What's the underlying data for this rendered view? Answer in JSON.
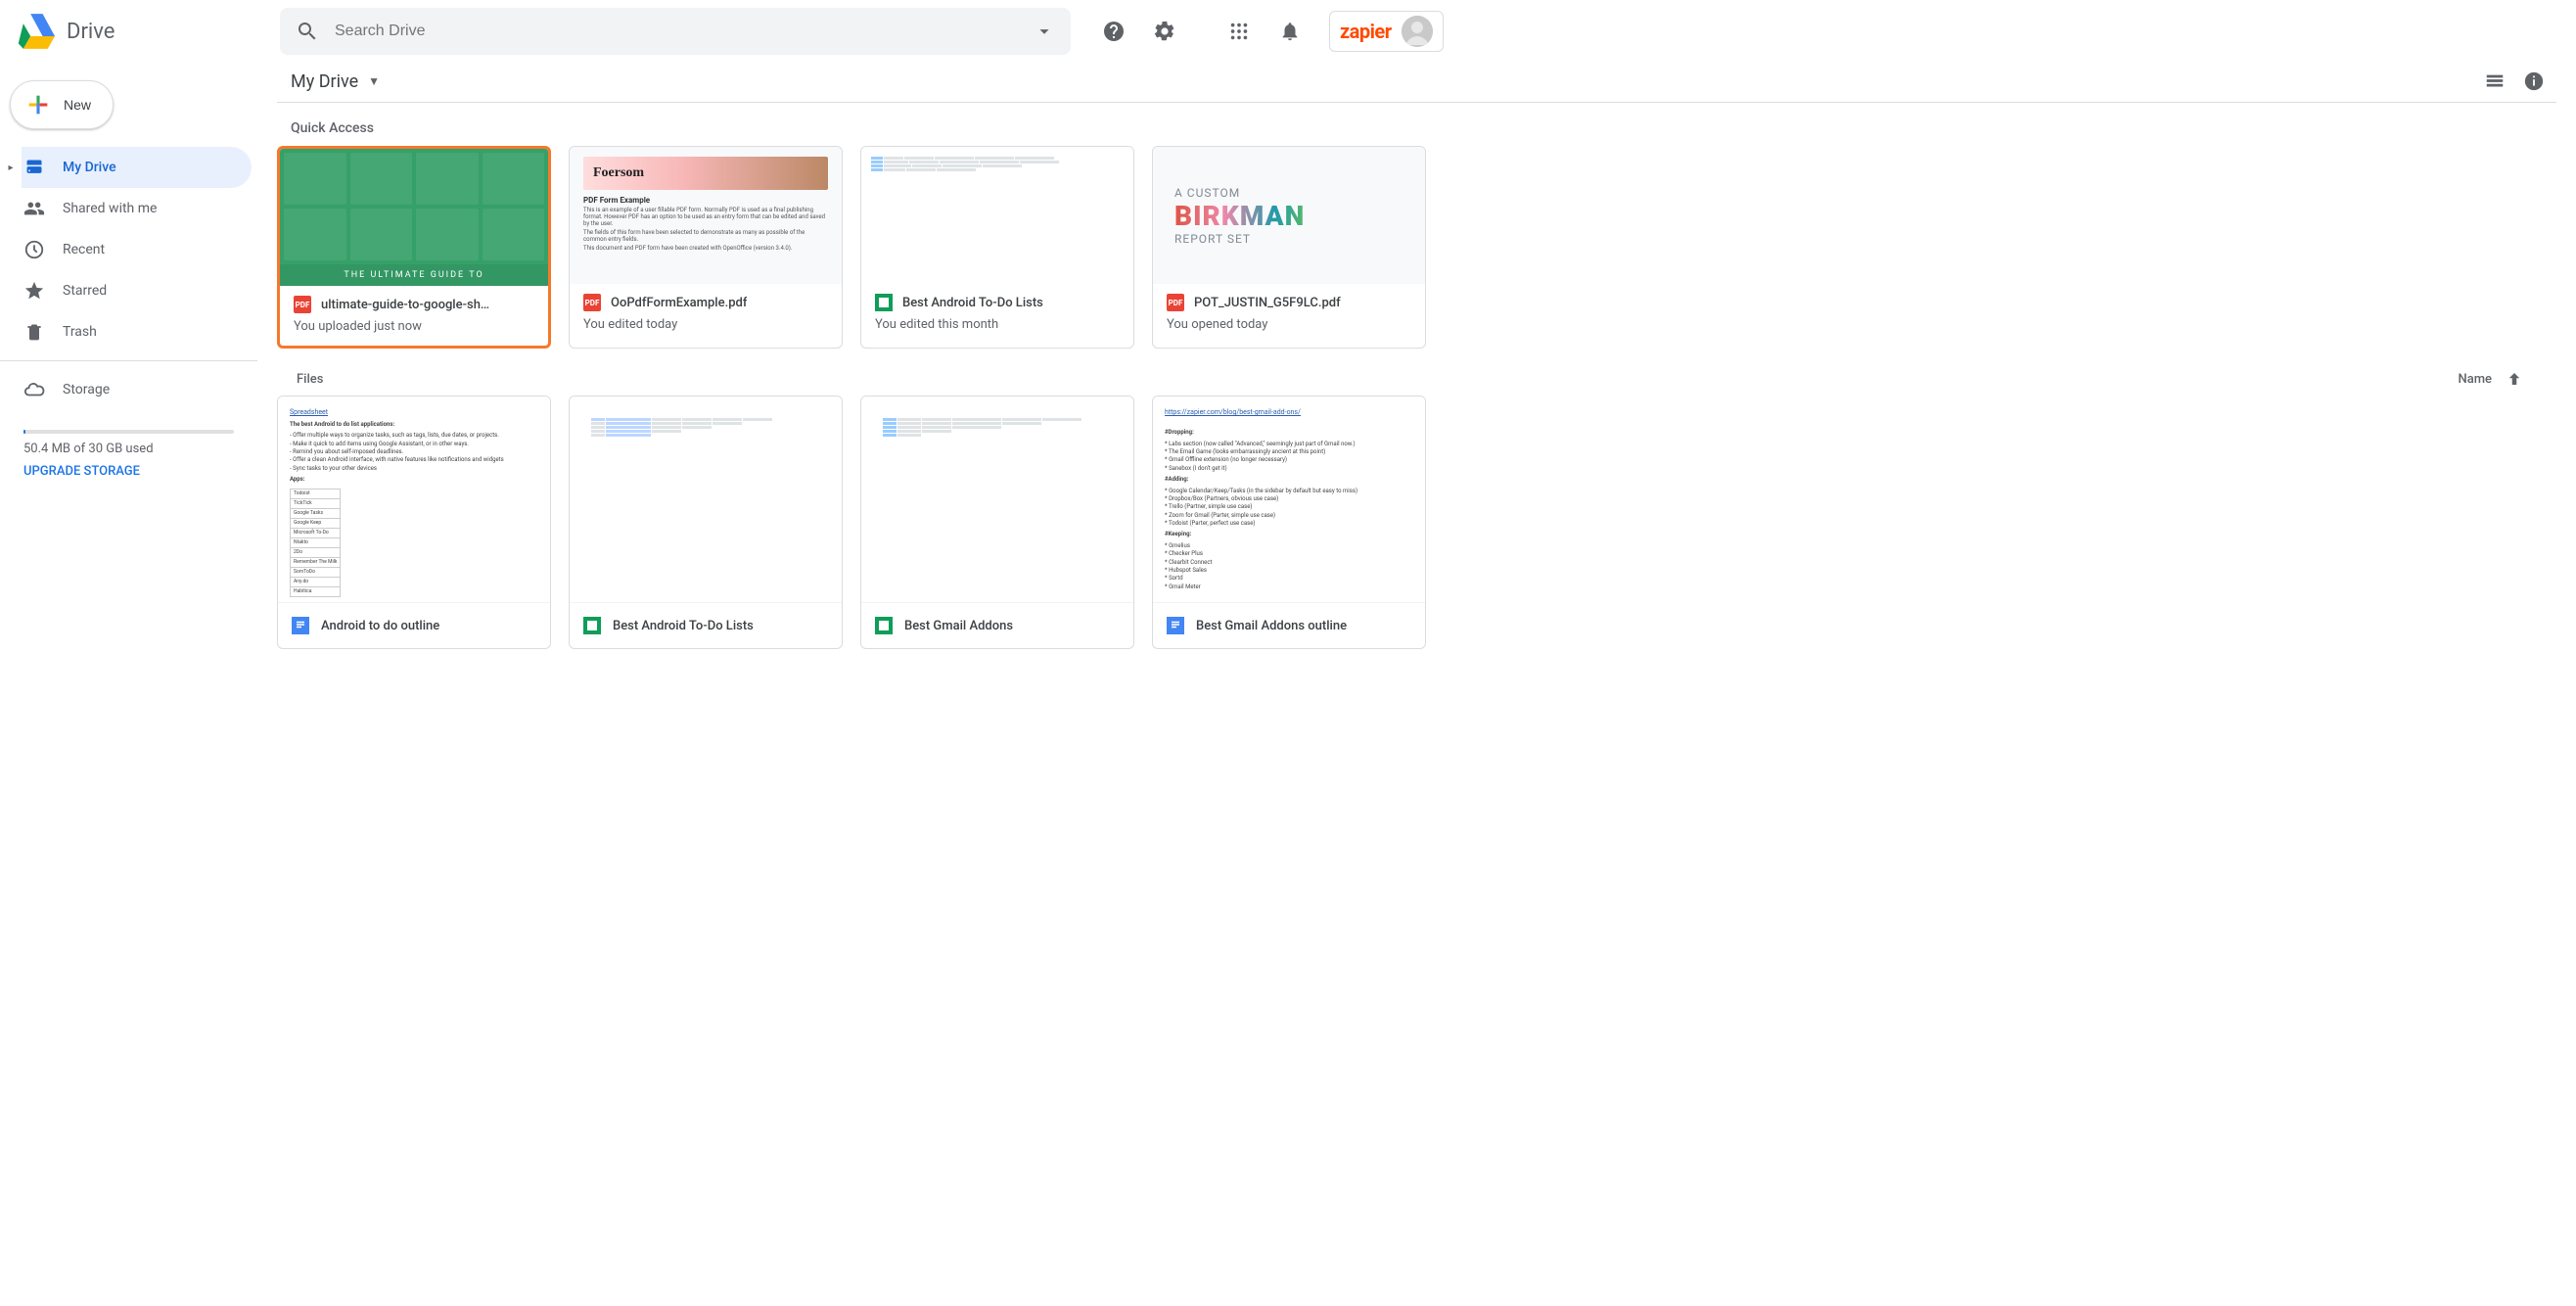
{
  "app": {
    "title": "Drive"
  },
  "search": {
    "placeholder": "Search Drive"
  },
  "newButton": {
    "label": "New"
  },
  "sidebar": {
    "items": [
      {
        "label": "My Drive"
      },
      {
        "label": "Shared with me"
      },
      {
        "label": "Recent"
      },
      {
        "label": "Starred"
      },
      {
        "label": "Trash"
      }
    ],
    "storage": {
      "heading": "Storage",
      "used": "50.4 MB of 30 GB used",
      "upgrade": "UPGRADE STORAGE"
    }
  },
  "breadcrumb": {
    "current": "My Drive"
  },
  "sections": {
    "quickAccess": "Quick Access",
    "files": "Files",
    "sortLabel": "Name"
  },
  "quickAccess": [
    {
      "title": "ultimate-guide-to-google-sh…",
      "subtitle": "You uploaded just now",
      "type": "pdf",
      "thumbText": "THE ULTIMATE GUIDE TO"
    },
    {
      "title": "OoPdfFormExample.pdf",
      "subtitle": "You edited today",
      "type": "pdf",
      "thumbBrand": "Foersom",
      "thumbHeading": "PDF Form Example"
    },
    {
      "title": "Best Android To-Do Lists",
      "subtitle": "You edited this month",
      "type": "sheet"
    },
    {
      "title": "POT_JUSTIN_G5F9LC.pdf",
      "subtitle": "You opened today",
      "type": "pdf",
      "birkman": {
        "l1": "A CUSTOM",
        "l2": "BIRKMAN",
        "l3": "REPORT SET"
      }
    }
  ],
  "files": [
    {
      "title": "Android to do outline",
      "type": "doc"
    },
    {
      "title": "Best Android To-Do Lists",
      "type": "sheet"
    },
    {
      "title": "Best Gmail Addons",
      "type": "sheet"
    },
    {
      "title": "Best Gmail Addons outline",
      "type": "doc"
    }
  ],
  "zapier": {
    "label": "zapier"
  },
  "iconLabels": {
    "pdf": "PDF"
  }
}
